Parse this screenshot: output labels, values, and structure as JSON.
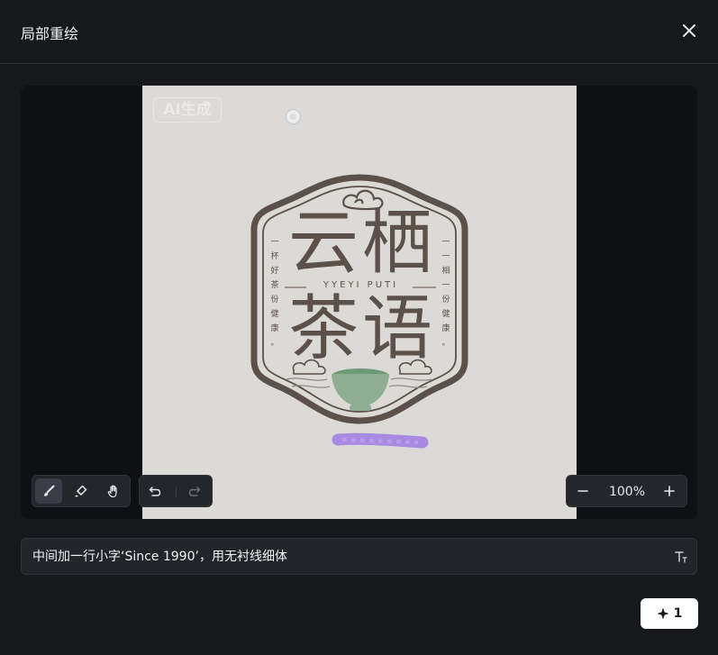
{
  "dialog": {
    "title": "局部重绘"
  },
  "canvas": {
    "ai_badge": "AI生成",
    "logo": {
      "line1": "云栖",
      "line2": "茶语",
      "pinyin": "YYEYI PUTI",
      "left_vertical": [
        "一",
        "杯",
        "好",
        "茶",
        "份",
        "健",
        "康",
        "。"
      ],
      "right_vertical": [
        "一",
        "一",
        "相",
        "一",
        "份",
        "健",
        "康",
        "。"
      ]
    }
  },
  "toolbar": {
    "tools": [
      "brush-tool",
      "eraser-tool",
      "hand-tool"
    ],
    "zoom_value": "100%"
  },
  "prompt": {
    "value": "中间加一行小字‘Since 1990’，用无衬线细体"
  },
  "generate": {
    "count": "1"
  },
  "colors": {
    "background": "#17181c",
    "logo_brown": "#5b504a",
    "tea_green": "#8fad92",
    "mask_purple": "#9a73e6"
  }
}
